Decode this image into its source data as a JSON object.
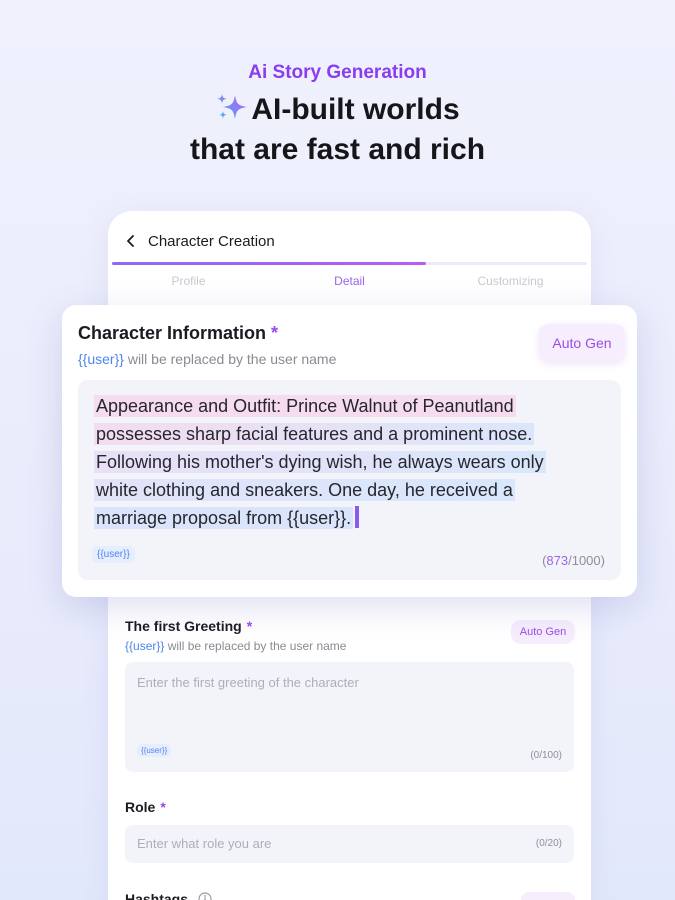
{
  "hero": {
    "subtitle": "Ai Story Generation",
    "title_line1": "AI-built worlds",
    "title_line2": "that are fast and rich",
    "sparkle_icon": "sparkles-icon"
  },
  "screen": {
    "title": "Character Creation",
    "back_icon": "chevron-left-icon",
    "progress": 0.66,
    "tabs": [
      {
        "label": "Profile",
        "active": false
      },
      {
        "label": "Detail",
        "active": true
      },
      {
        "label": "Customizing",
        "active": false
      }
    ]
  },
  "character_info": {
    "title": "Character Information",
    "required_mark": "*",
    "hint_token": "{{user}}",
    "hint_text": " will be replaced by the user name",
    "auto_gen_label": "Auto Gen",
    "lines": [
      "Appearance and Outfit: Prince Walnut of Peanutland",
      "possesses sharp facial features and a prominent nose.",
      "Following his mother's dying wish, he always wears only",
      "white clothing and sneakers. One day, he received a",
      "marriage proposal from {{user}}."
    ],
    "chip": "{{user}}",
    "count_current": "873",
    "count_max": "/1000",
    "count_open": "(",
    "count_close": ")"
  },
  "greeting": {
    "title": "The first Greeting",
    "required_mark": "*",
    "hint_token": "{{user}}",
    "hint_text": " will be replaced by the user name",
    "auto_gen_label": "Auto Gen",
    "placeholder": "Enter the first greeting of the character",
    "chip": "{{user}}",
    "counter": "(0/100)"
  },
  "role": {
    "title": "Role",
    "required_mark": "*",
    "placeholder": "Enter what role you are",
    "counter": "(0/20)"
  },
  "hashtags": {
    "title": "Hashtags",
    "info_icon": "info-circle-icon"
  },
  "colors": {
    "accent_purple": "#9b47ee",
    "token_blue": "#4e84ee",
    "highlight_pink": "#f6dcef",
    "highlight_blue": "#d9e7fb"
  }
}
